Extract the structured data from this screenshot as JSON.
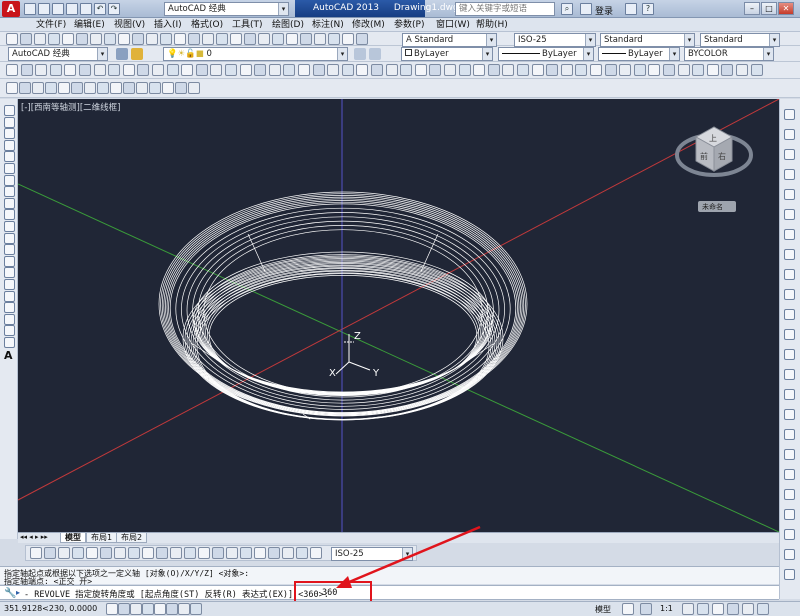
{
  "app": {
    "workspace": "AutoCAD 经典",
    "product": "AutoCAD 2013",
    "document": "Drawing1.dwg",
    "search_placeholder": "键入关键字或短语",
    "login_label": "登录"
  },
  "menu": [
    "文件(F)",
    "编辑(E)",
    "视图(V)",
    "插入(I)",
    "格式(O)",
    "工具(T)",
    "绘图(D)",
    "标注(N)",
    "修改(M)",
    "参数(P)",
    "窗口(W)",
    "帮助(H)"
  ],
  "toolbar": {
    "workspace_combo": "AutoCAD 经典",
    "layer_combo": "0",
    "text_style": "Standard",
    "dim_style": "ISO-25",
    "table_style": "Standard",
    "multileader_style": "Standard",
    "color": "ByLayer",
    "linetype": "ByLayer",
    "lineweight": "ByLayer",
    "plotstyle": "BYCOLOR",
    "dim_toolbar_style": "ISO-25"
  },
  "viewport": {
    "label": "[-][西南等轴测][二维线框]",
    "ucs_z": "Z",
    "ucs_x": "X",
    "ucs_y": "Y",
    "viewcube_top": "上",
    "viewcube_front": "前",
    "viewcube_right": "右",
    "viewcube_status": "未命名"
  },
  "layout_tabs": [
    "模型",
    "布局1",
    "布局2"
  ],
  "command": {
    "history": [
      "指定轴起点或根据以下选项之一定义轴 [对象(O)/X/Y/Z] <对象>:",
      "指定轴端点: <正交 开>"
    ],
    "prompt": "- REVOLVE 指定旋转角度或 [起点角度(ST) 反转(R) 表达式(EX)] <360>:",
    "value": "360"
  },
  "status": {
    "coords": "351.9128<230, 0.0000",
    "model_label": "模型",
    "scale": "1:1"
  },
  "colors": {
    "viewport_bg": "#202636",
    "highlight": "#e0141c",
    "x_axis_line": "#c0393b",
    "y_axis_line": "#3a9b3a",
    "z_axis_line": "#5353c8"
  }
}
